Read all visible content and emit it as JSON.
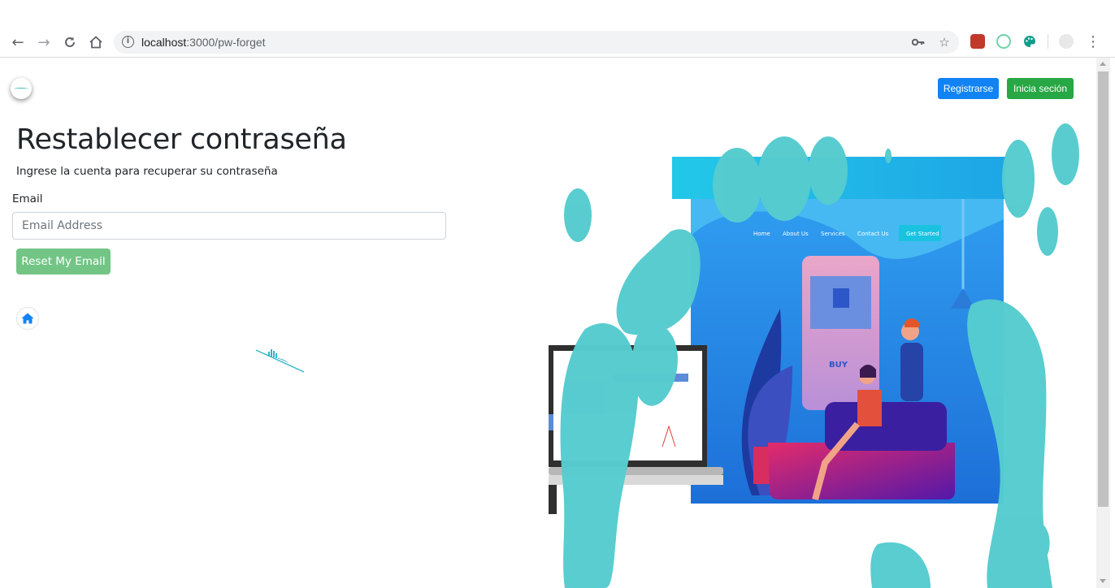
{
  "browser": {
    "url_host": "localhost",
    "url_path": ":3000/pw-forget",
    "back_icon": "arrow-left-icon",
    "forward_icon": "arrow-right-icon",
    "reload_icon": "reload-icon",
    "home_icon": "home-icon",
    "key_icon": "key-icon",
    "star_icon": "star-icon",
    "menu_icon": "more-vertical-icon"
  },
  "header": {
    "register_label": "Registrarse",
    "login_label": "Inicia seción",
    "register_color": "#1183f4",
    "login_color": "#28a745"
  },
  "form": {
    "title": "Restablecer contraseña",
    "subtitle": "Ingrese la cuenta para recuperar su contraseña",
    "email_label": "Email",
    "email_placeholder": "Email Address",
    "email_value": "",
    "reset_label": "Reset My Email",
    "reset_color": "#73c586"
  },
  "hero": {
    "nav_items": [
      "Home",
      "About Us",
      "Services",
      "Contact Us"
    ],
    "cta_label": "Get Started",
    "buy_label": "BUY",
    "accent": "#56cccf"
  }
}
